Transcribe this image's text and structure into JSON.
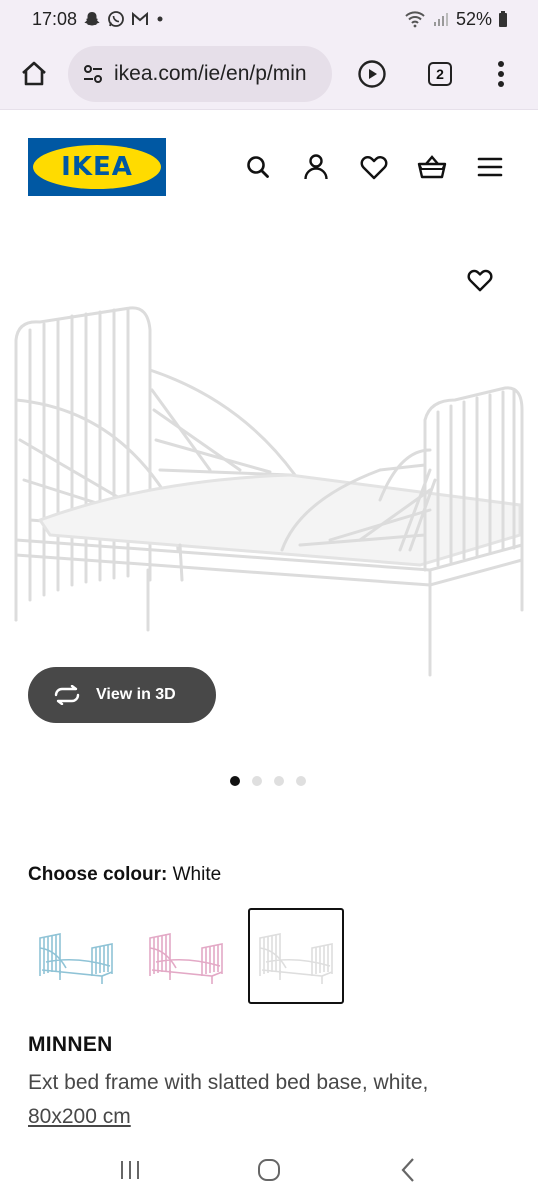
{
  "status_bar": {
    "time": "17:08",
    "battery": "52%"
  },
  "browser": {
    "url": "ikea.com/ie/en/p/min",
    "tab_count": "2"
  },
  "header": {
    "logo_text": "IKEA"
  },
  "product": {
    "view3d_label": "View in 3D",
    "image_dots": 4,
    "active_dot": 0,
    "colour_label": "Choose colour:",
    "colour_value": "White",
    "swatches": [
      {
        "name": "light blue",
        "color": "#8fc3d6"
      },
      {
        "name": "pink",
        "color": "#e3a9c6"
      },
      {
        "name": "white",
        "color": "#e5e5e5",
        "selected": true
      }
    ],
    "name": "MINNEN",
    "description": "Ext bed frame with slatted bed base, white,",
    "size": "80x200 cm"
  },
  "colors": {
    "ikea_blue": "#0058a3",
    "ikea_yellow": "#ffdb00",
    "pill_dark": "#484848"
  }
}
